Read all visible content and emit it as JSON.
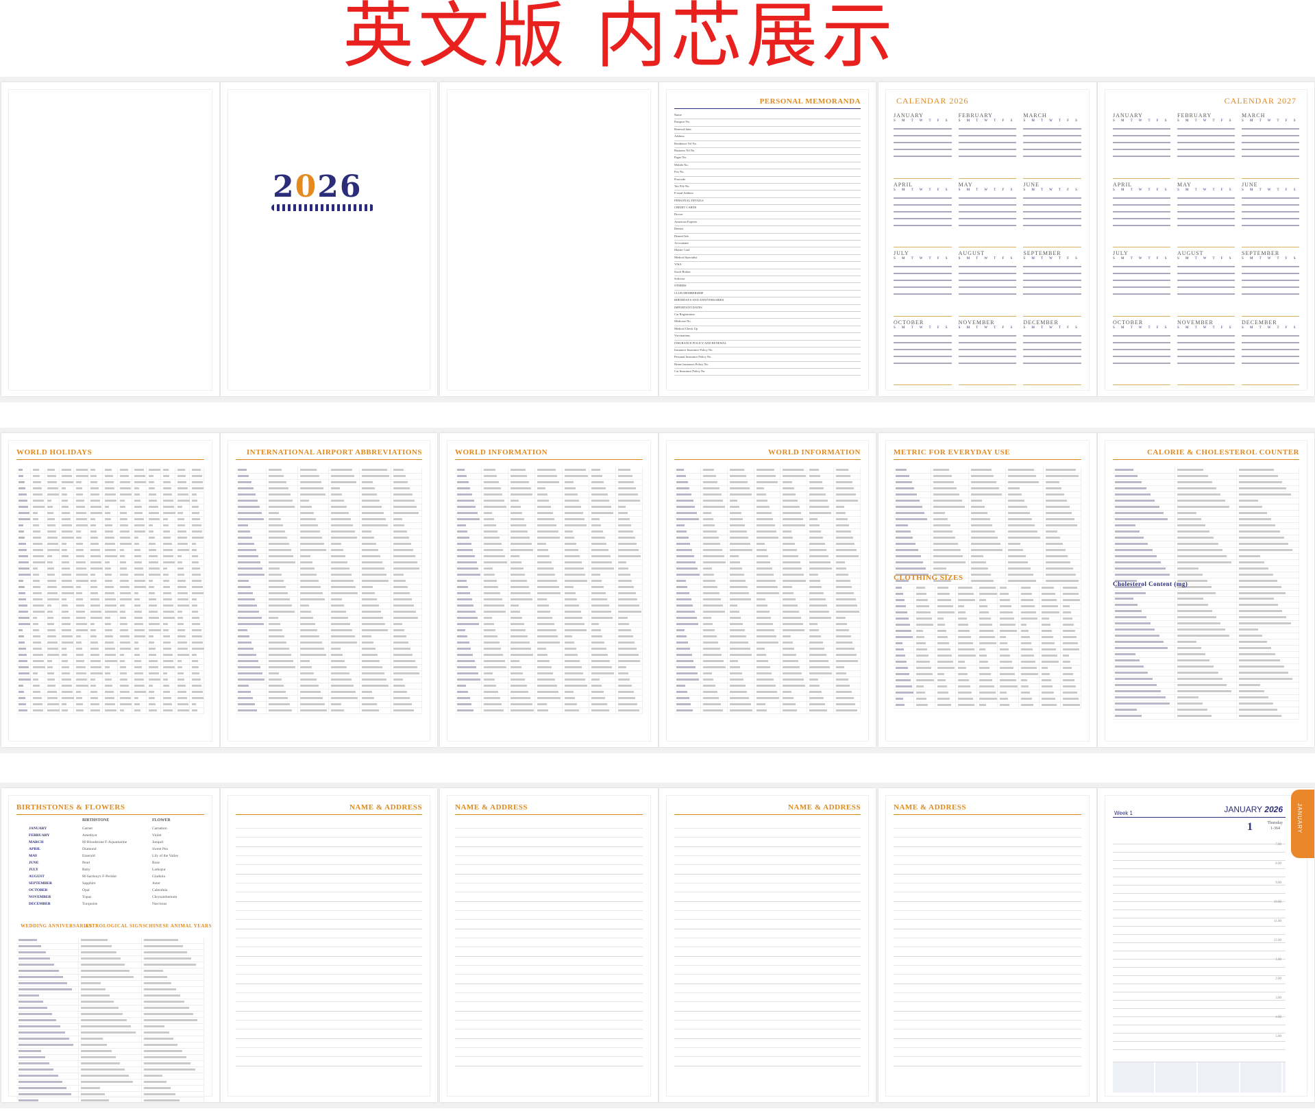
{
  "banner": {
    "title": "英文版 内芯展示"
  },
  "colors": {
    "accent": "#e08a1e",
    "navy": "#2b2d7a",
    "banner_red": "#e8201e"
  },
  "row1": {
    "cover": {
      "year_prefix": "2",
      "year_zero": "0",
      "year_suffix": "26"
    },
    "memoranda": {
      "title": "PERSONAL MEMORANDA",
      "labels": [
        "Name",
        "Passport No.",
        "Renewal date:",
        "Address",
        "Residence Tel No.",
        "Business Tel No",
        "Pager No.",
        "Mobile No.",
        "Fax No.",
        "Postcode",
        "Tax File No.",
        "E-mail Address",
        "PERSONAL DETAILS",
        "CREDIT CARDS",
        "Doctor",
        "American Express",
        "Dentist",
        "DinersClub",
        "Accountant",
        "Master Card",
        "Medical Specialist",
        "VISA",
        "Stock Broker",
        "Solicitor",
        "OTHERS",
        "CLUB MEMBERSHIP",
        "BIRTHDAYS AND ANNIVERSARIES",
        "IMPORTANT DATES",
        "Car Registration",
        "Medicare No.",
        "Medical Check Up",
        "Vaccinations",
        "INSURANCE POLICY AND RENEWAL",
        "Insurance Insurance Policy No.",
        "Personal Insurance Policy No.",
        "Home Insurance Policy No.",
        "Car Insurance Policy No."
      ]
    },
    "calendar_2026": {
      "title": "CALENDAR 2026"
    },
    "calendar_2027": {
      "title": "CALENDAR 2027"
    },
    "months": [
      "JANUARY",
      "FEBRUARY",
      "MARCH",
      "APRIL",
      "MAY",
      "JUNE",
      "JULY",
      "AUGUST",
      "SEPTEMBER",
      "OCTOBER",
      "NOVEMBER",
      "DECEMBER"
    ],
    "weekdays": "S M T W T F S"
  },
  "row2": {
    "world_holidays": {
      "title": "World Holidays",
      "columns": [
        "Country/City",
        "Jan.",
        "Feb.",
        "Mar.",
        "Apr.",
        "May",
        "Jun.",
        "Jul.",
        "Aug.",
        "Sep.",
        "Oct.",
        "Nov.",
        "Dec."
      ]
    },
    "airport": {
      "title": "International Airport Abbreviations"
    },
    "world_info_left": {
      "title": "World Information"
    },
    "world_info_right": {
      "title": "World Information"
    },
    "metric": {
      "title": "Metric For Everyday Use",
      "sub": "Clothing Sizes"
    },
    "calorie": {
      "title": "Calorie & Cholesterol Counter",
      "sub": "Cholesterol Content (mg)"
    }
  },
  "row3": {
    "birthstones": {
      "title": "Birthstones & Flowers",
      "col_birthstone": "BIRTHSTONE",
      "col_flower": "FLOWER",
      "months": [
        "JANUARY",
        "FEBRUARY",
        "MARCH",
        "APRIL",
        "MAY",
        "JUNE",
        "JULY",
        "AUGUST",
        "SEPTEMBER",
        "OCTOBER",
        "NOVEMBER",
        "DECEMBER"
      ],
      "stones": [
        "Garnet",
        "Amethyst",
        "M-Bloodstone F-Aquamarine",
        "Diamond",
        "Emerald",
        "Pearl",
        "Ruby",
        "M-Sardonyx F-Peridot",
        "Sapphire",
        "Opal",
        "Topaz",
        "Turquoise"
      ],
      "flowers": [
        "Carnation",
        "Violet",
        "Jonquil",
        "Sweet Pea",
        "Lily of the Valley",
        "Rose",
        "Larkspur",
        "Gladiola",
        "Aster",
        "Calendula",
        "Chrysanthemum",
        "Narcissus"
      ],
      "wedding": "Wedding Anniversaries",
      "astro": "Astrological Signs",
      "chinese": "Chinese Animal Years"
    },
    "name_address": "NAME & ADDRESS",
    "diary": {
      "week": "Week 1",
      "month_title": "JANUARY",
      "year": "2026",
      "day_num": "1",
      "weekday": "Thursday",
      "day_count": "1-364",
      "tab": "JANUARY",
      "hours": [
        "7.00",
        "8.00",
        "9.00",
        "10.00",
        "11.00",
        "12.00",
        "1.00",
        "2.00",
        "3.00",
        "4.00",
        "5.00"
      ]
    }
  }
}
